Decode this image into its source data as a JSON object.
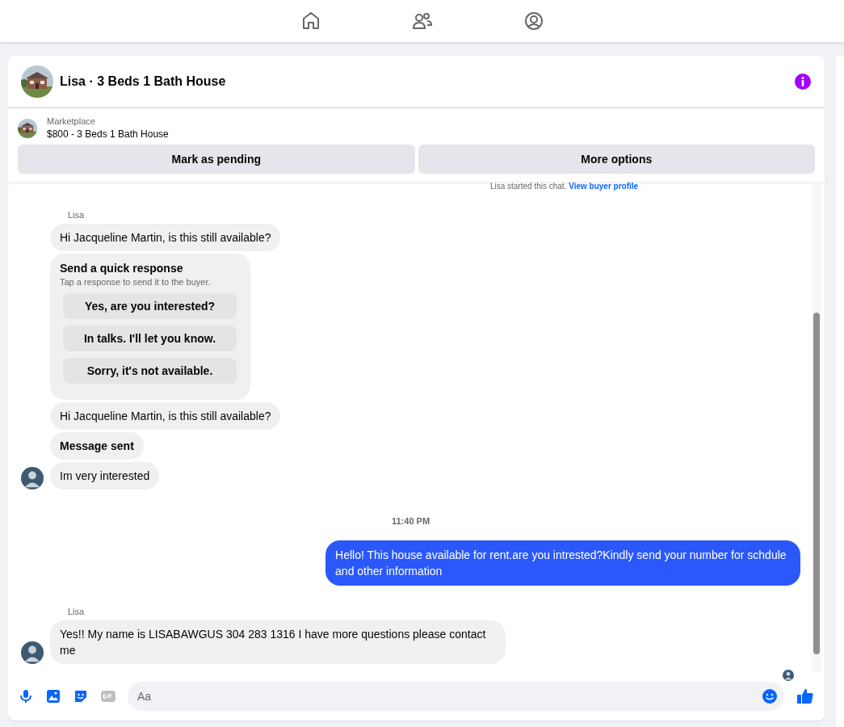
{
  "nav": {
    "items": [
      {
        "kind": "home",
        "selected": false
      },
      {
        "kind": "people",
        "selected": false
      },
      {
        "kind": "account",
        "selected": false
      }
    ]
  },
  "conversation": {
    "title": "Lisa · 3 Beds 1 Bath House"
  },
  "listing": {
    "source": "Marketplace",
    "title": "$800 - 3 Beds 1 Bath House",
    "actions": [
      "Mark as pending",
      "More options"
    ]
  },
  "chat_intro": {
    "text": "Lisa started this chat.",
    "link": "View buyer profile"
  },
  "messages": [
    {
      "kind": "sender",
      "text": "Lisa"
    },
    {
      "kind": "incoming",
      "text": "Hi Jacqueline Martin, is this still available?",
      "avatar": false
    },
    {
      "kind": "quick_response",
      "title": "Send a quick response",
      "subtitle": "Tap a response to send it to the buyer.",
      "options": [
        "Yes, are you interested?",
        "In talks. I'll let you know.",
        "Sorry, it's not available."
      ]
    },
    {
      "kind": "incoming",
      "text": "Hi Jacqueline Martin, is this still available?",
      "avatar": false
    },
    {
      "kind": "notice",
      "text": "Message sent"
    },
    {
      "kind": "incoming",
      "text": "Im very interested",
      "avatar": true
    },
    {
      "kind": "time",
      "text": "11:40 PM"
    },
    {
      "kind": "outgoing",
      "text": "Hello! This house available for rent.are you intrested?Kindly send your number for schdule and other information"
    },
    {
      "kind": "sender",
      "text": "Lisa"
    },
    {
      "kind": "incoming",
      "text": "Yes!! My name is LISABAWGUS 304 283 1316 I have more questions please contact me",
      "avatar": true
    }
  ],
  "composer": {
    "placeholder": "Aa"
  }
}
